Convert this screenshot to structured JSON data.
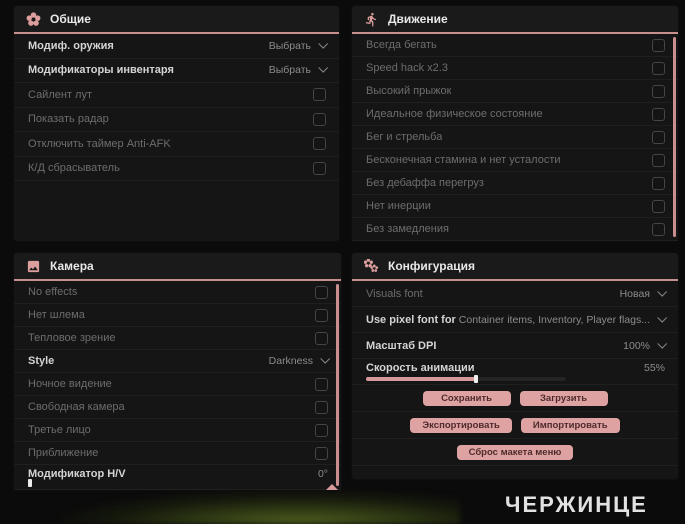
{
  "colors": {
    "accent": "#d79a9a",
    "header_underline": "#c98e8e",
    "button_bg": "#dfa2a2",
    "button_text": "#4d2b2b",
    "panel_bg": "#151515"
  },
  "watermark": "ЧЕРЖИНЦЕ",
  "panels": [
    {
      "id": "general",
      "title": "Общие",
      "icon": "flower-icon",
      "rows": [
        {
          "type": "dropdown",
          "label": "Модиф. оружия",
          "value": "Выбрать",
          "em": true
        },
        {
          "type": "dropdown",
          "label": "Модификаторы инвентаря",
          "value": "Выбрать",
          "em": true
        },
        {
          "type": "checkbox",
          "label": "Сайлент лут"
        },
        {
          "type": "checkbox",
          "label": "Показать радар"
        },
        {
          "type": "checkbox",
          "label": "Отключить таймер Anti-AFK"
        },
        {
          "type": "checkbox",
          "label": "К/Д сбрасыватель"
        }
      ]
    },
    {
      "id": "movement",
      "title": "Движение",
      "icon": "runner-icon",
      "scrollbar": true,
      "rows": [
        {
          "type": "checkbox",
          "label": "Всегда бегать"
        },
        {
          "type": "checkbox",
          "label": "Speed hack x2.3"
        },
        {
          "type": "checkbox",
          "label": "Высокий прыжок"
        },
        {
          "type": "checkbox",
          "label": "Идеальное физическое состояние"
        },
        {
          "type": "checkbox",
          "label": "Бег и стрельба"
        },
        {
          "type": "checkbox",
          "label": "Бесконечная стамина и нет усталости"
        },
        {
          "type": "checkbox",
          "label": "Без дебаффа перегруз"
        },
        {
          "type": "checkbox",
          "label": "Нет инерции"
        },
        {
          "type": "checkbox",
          "label": "Без замедления"
        }
      ]
    },
    {
      "id": "camera",
      "title": "Камера",
      "icon": "image-icon",
      "scrollbar": true,
      "rows": [
        {
          "type": "checkbox",
          "label": "No effects"
        },
        {
          "type": "checkbox",
          "label": "Нет шлема"
        },
        {
          "type": "checkbox",
          "label": "Тепловое зрение"
        },
        {
          "type": "dropdown",
          "label": "Style",
          "value": "Darkness",
          "em": true
        },
        {
          "type": "checkbox",
          "label": "Ночное видение"
        },
        {
          "type": "checkbox",
          "label": "Свободная камера"
        },
        {
          "type": "checkbox",
          "label": "Третье лицо"
        },
        {
          "type": "checkbox",
          "label": "Приближение"
        },
        {
          "type": "slider",
          "label": "Модификатор H/V",
          "value": "0°",
          "fill": 0,
          "em": true
        }
      ]
    },
    {
      "id": "config",
      "title": "Конфигурация",
      "icon": "gears-icon",
      "rows": [
        {
          "type": "dropdown",
          "label": "Visuals font",
          "value": "Новая"
        },
        {
          "type": "dropdown",
          "label": "Use pixel font for",
          "value": "Container items, Inventory, Player flags...",
          "em": true
        },
        {
          "type": "dropdown",
          "label": "Масштаб DPI",
          "value": "100%",
          "em": true
        },
        {
          "type": "slider",
          "label": "Скорость анимации",
          "value": "55%",
          "fill": 55,
          "em": true
        },
        {
          "type": "buttons",
          "buttons": [
            {
              "label": "Сохранить",
              "name": "save-button"
            },
            {
              "label": "Загрузить",
              "name": "load-button"
            }
          ]
        },
        {
          "type": "buttons",
          "buttons": [
            {
              "label": "Экспортировать",
              "name": "export-button"
            },
            {
              "label": "Импортировать",
              "name": "import-button"
            }
          ]
        },
        {
          "type": "buttons",
          "buttons": [
            {
              "label": "Сброс макета меню",
              "name": "reset-layout-button"
            }
          ]
        }
      ]
    }
  ]
}
